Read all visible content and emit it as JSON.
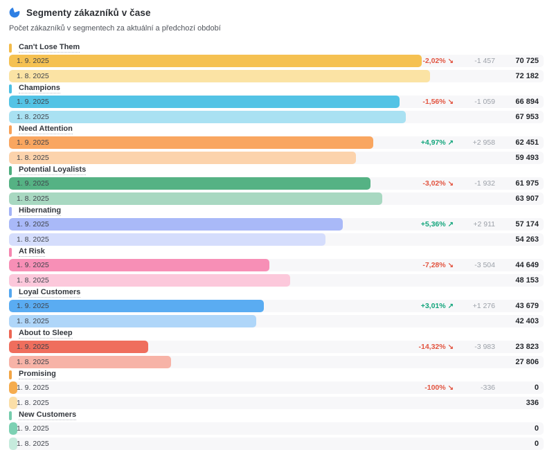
{
  "header": {
    "title": "Segmenty zákazníků v čase",
    "subtitle": "Počet zákazníků v segmentech za aktuální a předchozí období",
    "icon_color": "#2f80e4"
  },
  "colors": {
    "negative": "#e25440",
    "positive": "#13a57c",
    "diff_text": "#9ba0a8",
    "value_text": "#23262b",
    "track": "#f7f7f9"
  },
  "chart_data": {
    "type": "bar",
    "orientation": "horizontal",
    "title": "Segmenty zákazníků v čase",
    "periods": [
      "1. 9. 2025",
      "1. 8. 2025"
    ],
    "value_axis_max": 91600,
    "legend_position": "none",
    "grid": false,
    "segments": [
      {
        "name": "Can't Lose Them",
        "current_value": 70725,
        "previous_value": 72182,
        "current_display": "70 725",
        "previous_display": "72 182",
        "change_percent": "-2,02%",
        "change_direction": "down",
        "change_absolute": "-1 457",
        "bar_color": "#f5c152",
        "bar_color_prev": "#fbe3a4",
        "pill_color": "#f2bb4a"
      },
      {
        "name": "Champions",
        "current_value": 66894,
        "previous_value": 67953,
        "current_display": "66 894",
        "previous_display": "67 953",
        "change_percent": "-1,56%",
        "change_direction": "down",
        "change_absolute": "-1 059",
        "bar_color": "#53c3e5",
        "bar_color_prev": "#a9e1f2",
        "pill_color": "#4dbfe2"
      },
      {
        "name": "Need Attention",
        "current_value": 62451,
        "previous_value": 59493,
        "current_display": "62 451",
        "previous_display": "59 493",
        "change_percent": "+4,97%",
        "change_direction": "up",
        "change_absolute": "+2 958",
        "bar_color": "#f9a660",
        "bar_color_prev": "#fcd3ac",
        "pill_color": "#f8a157"
      },
      {
        "name": "Potential Loyalists",
        "current_value": 61975,
        "previous_value": 63907,
        "current_display": "61 975",
        "previous_display": "63 907",
        "change_percent": "-3,02%",
        "change_direction": "down",
        "change_absolute": "-1 932",
        "bar_color": "#55b284",
        "bar_color_prev": "#a8d8c1",
        "pill_color": "#4ead7e"
      },
      {
        "name": "Hibernating",
        "current_value": 57174,
        "previous_value": 54263,
        "current_display": "57 174",
        "previous_display": "54 263",
        "change_percent": "+5,36%",
        "change_direction": "up",
        "change_absolute": "+2 911",
        "bar_color": "#a9b9f8",
        "bar_color_prev": "#d5ddfc",
        "pill_color": "#a3b3f6"
      },
      {
        "name": "At Risk",
        "current_value": 44649,
        "previous_value": 48153,
        "current_display": "44 649",
        "previous_display": "48 153",
        "change_percent": "-7,28%",
        "change_direction": "down",
        "change_absolute": "-3 504",
        "bar_color": "#f78fb6",
        "bar_color_prev": "#fcc8db",
        "pill_color": "#f587b0"
      },
      {
        "name": "Loyal Customers",
        "current_value": 43679,
        "previous_value": 42403,
        "current_display": "43 679",
        "previous_display": "42 403",
        "change_percent": "+3,01%",
        "change_direction": "up",
        "change_absolute": "+1 276",
        "bar_color": "#5aacf2",
        "bar_color_prev": "#afd6f9",
        "pill_color": "#54a7f0"
      },
      {
        "name": "About to Sleep",
        "current_value": 23823,
        "previous_value": 27806,
        "current_display": "23 823",
        "previous_display": "27 806",
        "change_percent": "-14,32%",
        "change_direction": "down",
        "change_absolute": "-3 983",
        "bar_color": "#ef6e5d",
        "bar_color_prev": "#f7b3a7",
        "pill_color": "#ed6654"
      },
      {
        "name": "Promising",
        "current_value": 0,
        "previous_value": 336,
        "current_display": "0",
        "previous_display": "336",
        "change_percent": "-100%",
        "change_direction": "down",
        "change_absolute": "-336",
        "bar_color": "#f5ac4e",
        "bar_color_prev": "#fbdfa8",
        "pill_color": "#f2a545"
      },
      {
        "name": "New Customers",
        "current_value": 0,
        "previous_value": 0,
        "current_display": "0",
        "previous_display": "0",
        "change_percent": null,
        "change_direction": null,
        "change_absolute": null,
        "bar_color": "#7dd1b3",
        "bar_color_prev": "#c6ebdd",
        "pill_color": "#76cdad"
      }
    ]
  },
  "icons": {
    "trend_up": "↗",
    "trend_down": "↘",
    "header": "pie-chart-icon"
  }
}
